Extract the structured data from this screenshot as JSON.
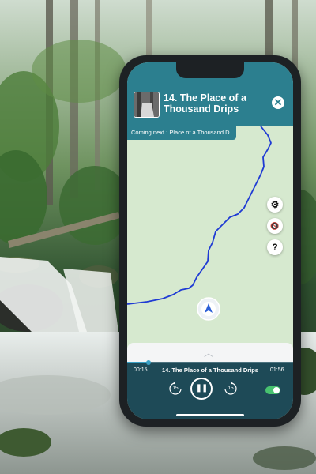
{
  "background": {
    "scene": "forest-waterfall-photo",
    "colors": {
      "foliage": "#3f6b3a",
      "mist": "#cfdccf",
      "water": "#e8ecea",
      "rock": "#2d2f2c"
    }
  },
  "app": {
    "accent": "#2c7f8f",
    "header": {
      "title": "14. The Place of a Thousand Drips",
      "thumbnail_icon": "waterfall-thumbnail",
      "close_icon": "close-icon",
      "close_glyph": "✕"
    },
    "coming_next": "Coming next : Place of a Thousand D...",
    "map": {
      "land_color": "#d6e9cf",
      "route_color": "#1f3bd4",
      "buttons": [
        {
          "name": "settings-button",
          "icon": "gear-icon",
          "glyph": "⚙"
        },
        {
          "name": "audio-toggle-button",
          "icon": "speaker-muted-icon",
          "glyph": "🔇"
        },
        {
          "name": "help-button",
          "icon": "question-icon",
          "glyph": "?"
        }
      ],
      "location_marker": "navigation-arrow-icon",
      "stop_marker": "check-icon",
      "stop_glyph": "✓"
    },
    "drawer_handle_glyph": "︿",
    "player": {
      "elapsed": "00:15",
      "track_title": "14. The Place of a Thousand Drips",
      "duration": "01:56",
      "progress_fraction": 0.13,
      "rewind_label": "15",
      "forward_label": "15",
      "play_state": "paused-icon",
      "pause_glyph": "❚❚",
      "autoplay_on": true
    }
  }
}
